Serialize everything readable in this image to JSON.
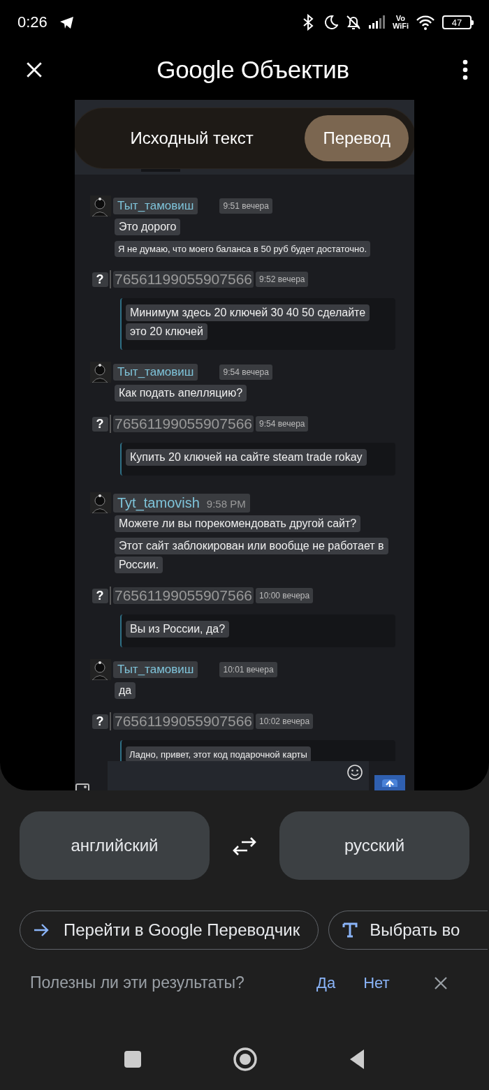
{
  "status_bar": {
    "time": "0:26",
    "network_label": [
      "Vo",
      "WiFi"
    ],
    "battery": "47"
  },
  "header": {
    "title": "Google Объектив"
  },
  "mode_toggle": [
    {
      "label": "Исходный текст",
      "selected": false
    },
    {
      "label": "Перевод",
      "selected": true
    }
  ],
  "chat": {
    "messages": [
      {
        "kind": "avatar",
        "author": "Тыт_тамовиш",
        "time": "9:51 вечера",
        "merged": false,
        "quoted": false,
        "bubbles": [
          {
            "small": false,
            "lines": [
              "Это дорого"
            ]
          },
          {
            "small": true,
            "lines": [
              "Я не думаю, что моего баланса в 50 руб будет достаточно."
            ]
          }
        ]
      },
      {
        "kind": "unknown",
        "icon_text": "?",
        "author": "76561199055907566",
        "time": "9:52 вечера",
        "merged": false,
        "quoted": true,
        "bubbles": [
          {
            "small": false,
            "lines": [
              "Минимум здесь 20 ключей 30 40 50 сделайте",
              "это 20 ключей"
            ]
          }
        ]
      },
      {
        "kind": "avatar",
        "author": "Тыт_тамовиш",
        "time": "9:54 вечера",
        "merged": false,
        "quoted": false,
        "bubbles": [
          {
            "small": false,
            "lines": [
              "Как подать апелляцию?"
            ]
          }
        ]
      },
      {
        "kind": "unknown",
        "icon_text": "?",
        "author": "76561199055907566",
        "time": "9:54 вечера",
        "merged": false,
        "quoted": true,
        "bubbles": [
          {
            "small": false,
            "lines": [
              "Купить 20 ключей на сайте steam trade rokay"
            ]
          }
        ]
      },
      {
        "kind": "avatar",
        "author": "Tyt_tamovish",
        "time": "9:58 PM",
        "merged": true,
        "quoted": false,
        "bubbles": [
          {
            "small": false,
            "lines": [
              "Можете ли вы порекомендовать другой сайт?"
            ]
          },
          {
            "small": false,
            "lines": [
              "Этот сайт заблокирован или вообще не работает в",
              "России."
            ]
          }
        ]
      },
      {
        "kind": "unknown",
        "icon_text": "?",
        "author": "76561199055907566",
        "time": "10:00 вечера",
        "merged": false,
        "quoted": true,
        "bubbles": [
          {
            "small": false,
            "lines": [
              "Вы из России, да?"
            ]
          }
        ]
      },
      {
        "kind": "avatar",
        "author": "Тыт_тамовиш",
        "time": "10:01 вечера",
        "merged": false,
        "quoted": false,
        "bubbles": [
          {
            "small": false,
            "lines": [
              "да"
            ]
          }
        ]
      },
      {
        "kind": "unknown",
        "icon_text": "?",
        "author": "76561199055907566",
        "time": "10:02 вечера",
        "merged": false,
        "quoted": true,
        "bubbles": [
          {
            "small": true,
            "lines": [
              "Ладно, привет, этот код подарочной карты"
            ]
          }
        ]
      }
    ]
  },
  "languages": {
    "source": "английский",
    "target": "русский"
  },
  "actions": [
    {
      "kind": "arrow",
      "label": "Перейти в Google Переводчик"
    },
    {
      "kind": "text",
      "label": "Выбрать во"
    }
  ],
  "feedback": {
    "question": "Полезны ли эти результаты?",
    "yes": "Да",
    "no": "Нет"
  }
}
